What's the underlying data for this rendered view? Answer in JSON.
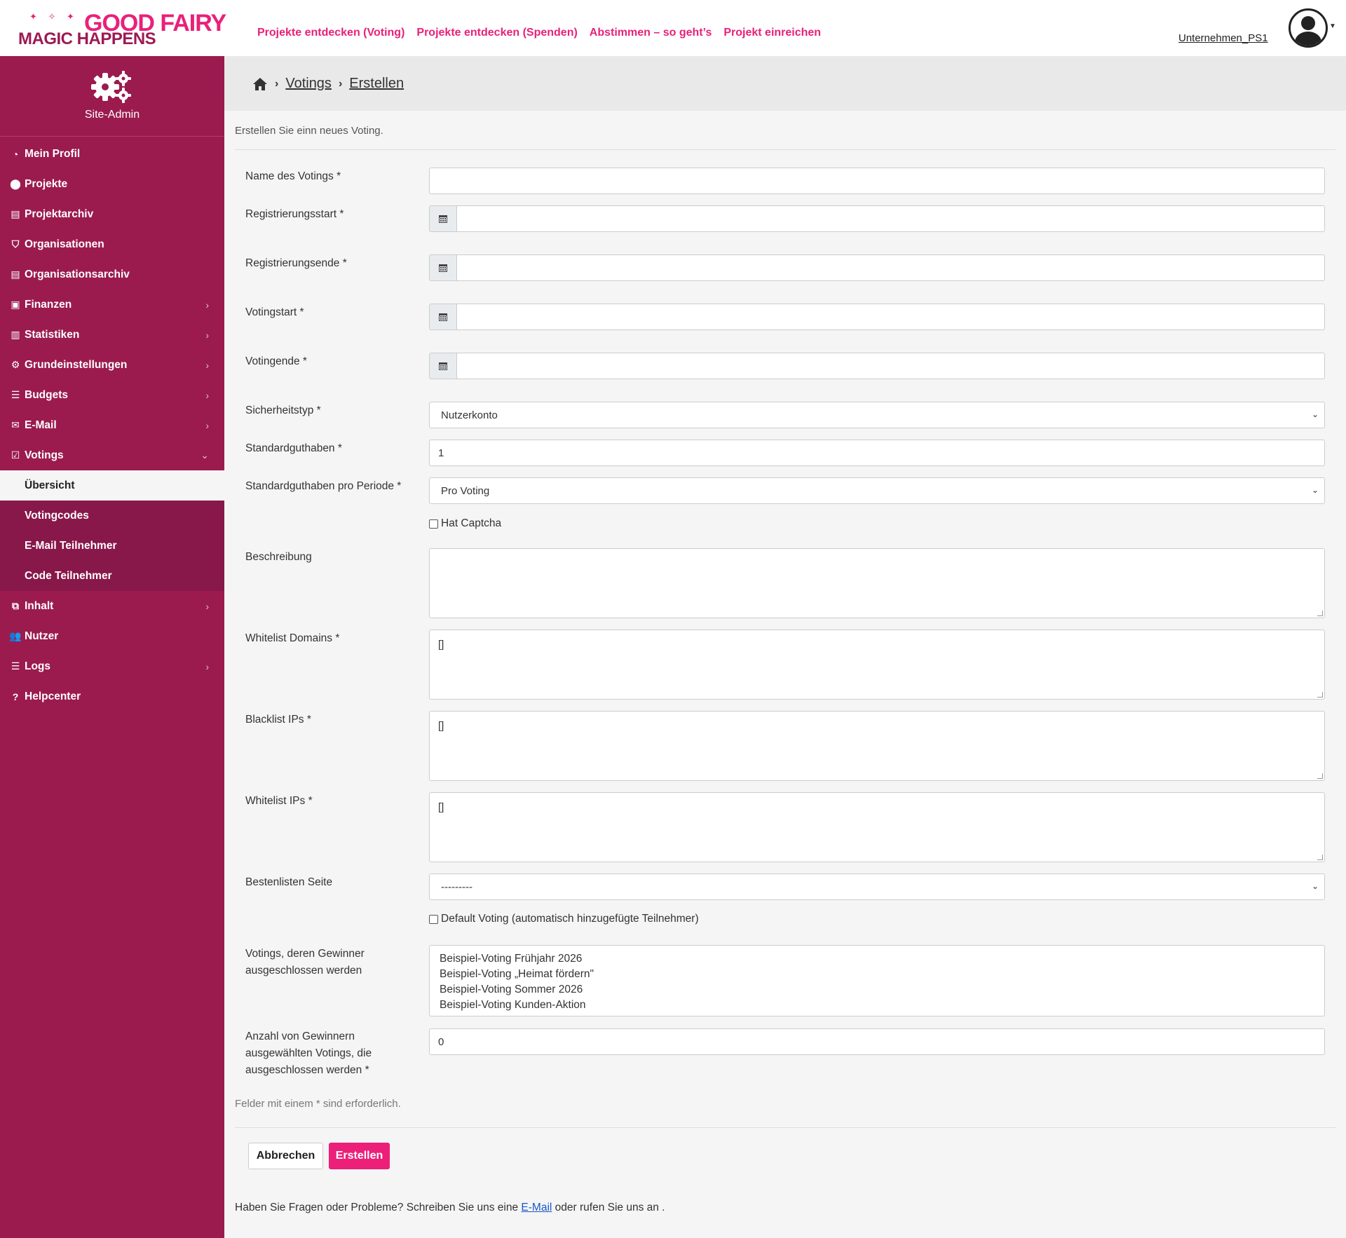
{
  "header": {
    "logo_top": "GOOD FAIRY",
    "logo_bottom": "MAGIC HAPPENS",
    "nav": [
      "Projekte entdecken (Voting)",
      "Projekte entdecken (Spenden)",
      "Abstimmen – so geht’s",
      "Projekt einreichen"
    ],
    "user": "Unternehmen_PS1"
  },
  "sidebar": {
    "title": "Site-Admin",
    "items": [
      {
        "label": "Mein Profil",
        "icon": "dashboard-icon"
      },
      {
        "label": "Projekte",
        "icon": "map-marker-icon"
      },
      {
        "label": "Projektarchiv",
        "icon": "archive-icon"
      },
      {
        "label": "Organisationen",
        "icon": "shield-icon"
      },
      {
        "label": "Organisationsarchiv",
        "icon": "archive-icon"
      },
      {
        "label": "Finanzen",
        "icon": "money-icon"
      },
      {
        "label": "Statistiken",
        "icon": "bar-chart-icon"
      },
      {
        "label": "Grundeinstellungen",
        "icon": "cogs-icon"
      },
      {
        "label": "Budgets",
        "icon": "list-icon"
      },
      {
        "label": "E-Mail",
        "icon": "envelope-icon"
      },
      {
        "label": "Votings",
        "icon": "check-square-icon"
      }
    ],
    "sub_items": [
      "Übersicht",
      "Votingcodes",
      "E-Mail Teilnehmer",
      "Code Teilnehmer"
    ],
    "items_after": [
      {
        "label": "Inhalt",
        "icon": "sitemap-icon"
      },
      {
        "label": "Nutzer",
        "icon": "users-icon"
      },
      {
        "label": "Logs",
        "icon": "list-icon"
      },
      {
        "label": "Helpcenter",
        "icon": "question-circle-icon"
      }
    ]
  },
  "breadcrumb": {
    "level1": "Votings",
    "level2": "Erstellen"
  },
  "intro": "Erstellen Sie einn neues Voting.",
  "form": {
    "name_label": "Name des Votings *",
    "reg_start_label": "Registrierungsstart *",
    "reg_end_label": "Registrierungsende *",
    "vote_start_label": "Votingstart *",
    "vote_end_label": "Votingende *",
    "security_label": "Sicherheitstyp *",
    "security_value": "Nutzerkonto",
    "credit_label": "Standardguthaben *",
    "credit_value": "1",
    "credit_period_label": "Standardguthaben pro Periode *",
    "credit_period_value": "Pro Voting",
    "captcha_label": "Hat Captcha",
    "description_label": "Beschreibung",
    "whitelist_domains_label": "Whitelist Domains *",
    "whitelist_domains_value": "[]",
    "blacklist_ips_label": "Blacklist IPs *",
    "blacklist_ips_value": "[]",
    "whitelist_ips_label": "Whitelist IPs *",
    "whitelist_ips_value": "[]",
    "leaderboard_label": "Bestenlisten Seite",
    "leaderboard_value": "---------",
    "default_voting_label": "Default Voting (automatisch hinzugefügte Teilnehmer)",
    "excluded_label_1": "Votings, deren Gewinner",
    "excluded_label_2": "ausgeschlossen werden",
    "excluded_options": [
      "Beispiel-Voting Frühjahr 2026",
      "Beispiel-Voting „Heimat fördern\"",
      "Beispiel-Voting Sommer 2026",
      "Beispiel-Voting Kunden-Aktion"
    ],
    "winners_label_1": "Anzahl von Gewinnern",
    "winners_label_2": "ausgewählten Votings, die",
    "winners_label_3": "ausgeschlossen werden *",
    "winners_value": "0"
  },
  "required_note": "Felder mit einem * sind erforderlich.",
  "buttons": {
    "cancel": "Abbrechen",
    "create": "Erstellen"
  },
  "footer": {
    "text_before": "Haben Sie Fragen oder Probleme? Schreiben Sie uns eine ",
    "link": "E-Mail",
    "text_after": " oder rufen Sie uns an ."
  },
  "colors": {
    "primary": "#9b1b4f",
    "accent": "#ec1f79"
  }
}
